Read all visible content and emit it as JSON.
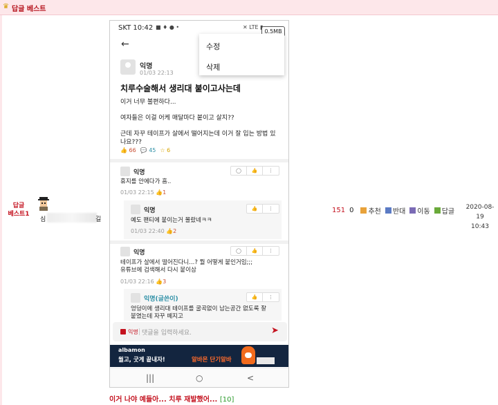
{
  "header": {
    "title": "답글 베스트"
  },
  "row": {
    "board_label": "답글\n베스트1",
    "author_prefix": "심",
    "author_suffix": "길",
    "views": "151",
    "comment_count": "0",
    "recommend_label": "추천",
    "oppose_label": "반대",
    "move_label": "이동",
    "reply_label": "답글",
    "date": "2020-08-19",
    "time": "10:43"
  },
  "phone": {
    "status_time": "SKT 10:42",
    "status_icons": "■ ♦ ● •",
    "right_icons": "✕ LTE ▮",
    "mem_badge": "0.5MB",
    "menu": {
      "edit": "수정",
      "delete": "삭제"
    },
    "post": {
      "author": "익명",
      "time": "01/03 22:13",
      "title": "치루수술해서 생리대 붙이고사는데",
      "body": [
        "이거 너무 불편하다...",
        "여자들은 이걸 어케 매달마다 붙이고 살지??",
        "근데 자꾸 테이프가 살에서 떨어지는데 이거 잘 입는 방법 있나요???"
      ],
      "likes": "66",
      "comments": "45",
      "stars": "6"
    },
    "comments": [
      {
        "author": "익명",
        "text": "휴지를 안에다가 흠..",
        "time": "01/03 22:15",
        "likes": "1"
      },
      {
        "author": "익명",
        "text": "예도 팬티에 붙이는거 몰랐네ㅋㅋ",
        "time": "01/03 22:40",
        "likes": "2"
      },
      {
        "author": "익명",
        "text": "테이프가 살에서 떨어진다니...? 뭘 어떻게 붙인거임;;;\n유튜브에 검색해서 다시 붙이삼",
        "time": "01/03 22:16",
        "likes": "3"
      },
      {
        "author": "익명(글쓴이)",
        "text": "엉덩이에 생리대 테이프를 굴곡없이 남는공간 없도록 잘\n붙였는데 자꾸 떼지고",
        "time": "",
        "likes": ""
      }
    ],
    "input": {
      "anon_label": "익명",
      "placeholder": "댓글을 입력하세요."
    },
    "ad": {
      "brand": "albamon",
      "copy": "월고, 굿게 끝내자!",
      "copy2": "알바몬 단기알바"
    },
    "nav": {
      "recent": "|||",
      "home": "○",
      "back": "<"
    }
  },
  "footer": {
    "link": "이거 나야 예들아... 치루 재발했어...",
    "count": "[10]"
  },
  "colors": {
    "accent": "#c4121f",
    "teal": "#2d8fa6",
    "header_bg": "#fde7ea",
    "ad_bg": "#13253f"
  }
}
